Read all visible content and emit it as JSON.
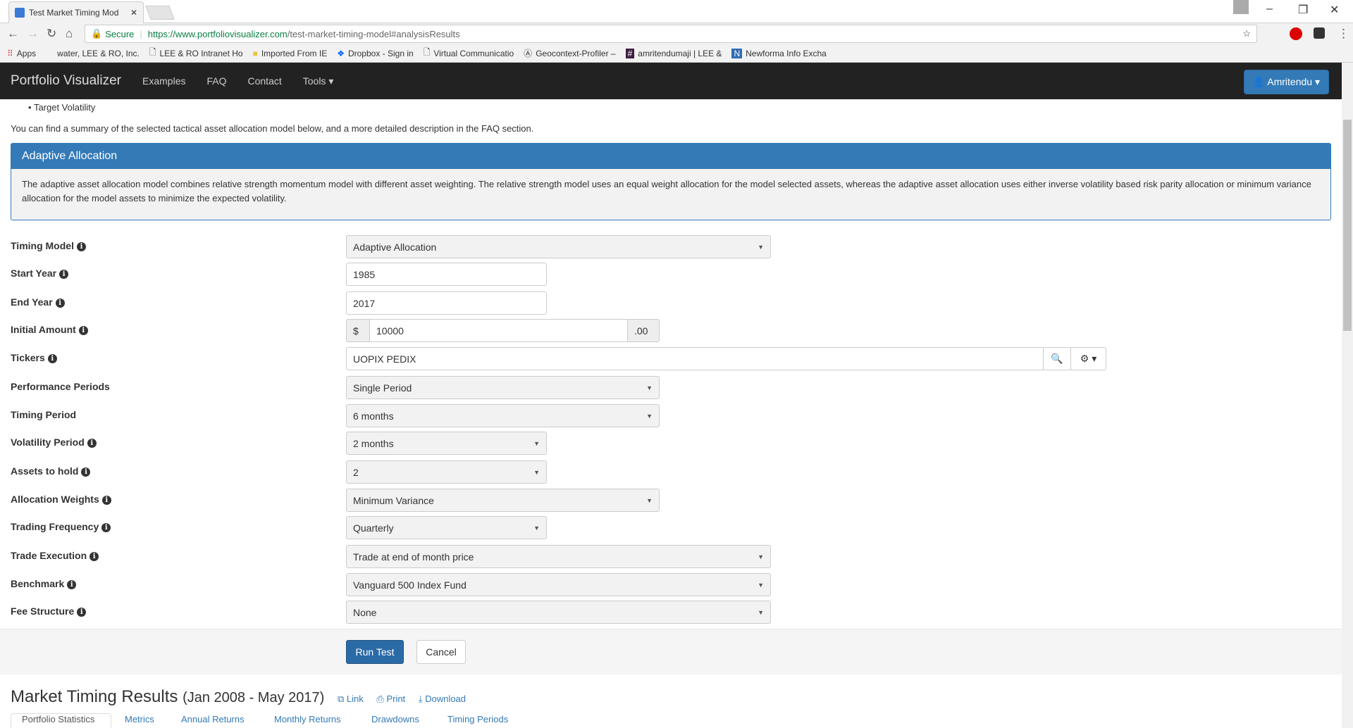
{
  "browser": {
    "tab_title": "Test Market Timing Mod",
    "url_secure": "Secure",
    "url_host": "https://www.portfoliovisualizer.com",
    "url_path": "/test-market-timing-model#analysisResults",
    "bookmarks": [
      "Apps",
      "water, LEE & RO, Inc.",
      "LEE & RO Intranet Ho",
      "Imported From IE",
      "Dropbox - Sign in",
      "Virtual Communicatio",
      "Geocontext-Profiler –",
      "amritendumaji | LEE &",
      "Newforma Info Excha"
    ]
  },
  "nav": {
    "brand": "Portfolio Visualizer",
    "links": [
      "Examples",
      "FAQ",
      "Contact",
      "Tools ▾"
    ],
    "user": "Amritendu ▾"
  },
  "intro": {
    "bullet": "Target Volatility",
    "summary": "You can find a summary of the selected tactical asset allocation model below, and a more detailed description in the FAQ section."
  },
  "panel": {
    "title": "Adaptive Allocation",
    "body": "The adaptive asset allocation model combines relative strength momentum model with different asset weighting. The relative strength model uses an equal weight allocation for the model selected assets, whereas the adaptive asset allocation uses either inverse volatility based risk parity allocation or minimum variance allocation for the model assets to minimize the expected volatility."
  },
  "form": [
    {
      "label": "Timing Model",
      "value": "Adaptive Allocation"
    },
    {
      "label": "Start Year",
      "value": "1985"
    },
    {
      "label": "End Year",
      "value": "2017"
    },
    {
      "label": "Initial Amount",
      "value": "10000",
      "prefix": "$",
      "suffix": ".00"
    },
    {
      "label": "Tickers",
      "value": "UOPIX PEDIX"
    },
    {
      "label": "Performance Periods",
      "value": "Single Period"
    },
    {
      "label": "Timing Period",
      "value": "6 months"
    },
    {
      "label": "Volatility Period",
      "value": "2 months"
    },
    {
      "label": "Assets to hold",
      "value": "2"
    },
    {
      "label": "Allocation Weights",
      "value": "Minimum Variance"
    },
    {
      "label": "Trading Frequency",
      "value": "Quarterly"
    },
    {
      "label": "Trade Execution",
      "value": "Trade at end of month price"
    },
    {
      "label": "Benchmark",
      "value": "Vanguard 500 Index Fund"
    },
    {
      "label": "Fee Structure",
      "value": "None"
    }
  ],
  "buttons": {
    "run": "Run Test",
    "cancel": "Cancel"
  },
  "results": {
    "title": "Market Timing Results",
    "range": "(Jan 2008 - May 2017)",
    "link": "Link",
    "print": "Print",
    "download": "Download",
    "tabs": [
      "Portfolio Statistics",
      "Metrics",
      "Annual Returns",
      "Monthly Returns",
      "Drawdowns",
      "Timing Periods"
    ]
  }
}
